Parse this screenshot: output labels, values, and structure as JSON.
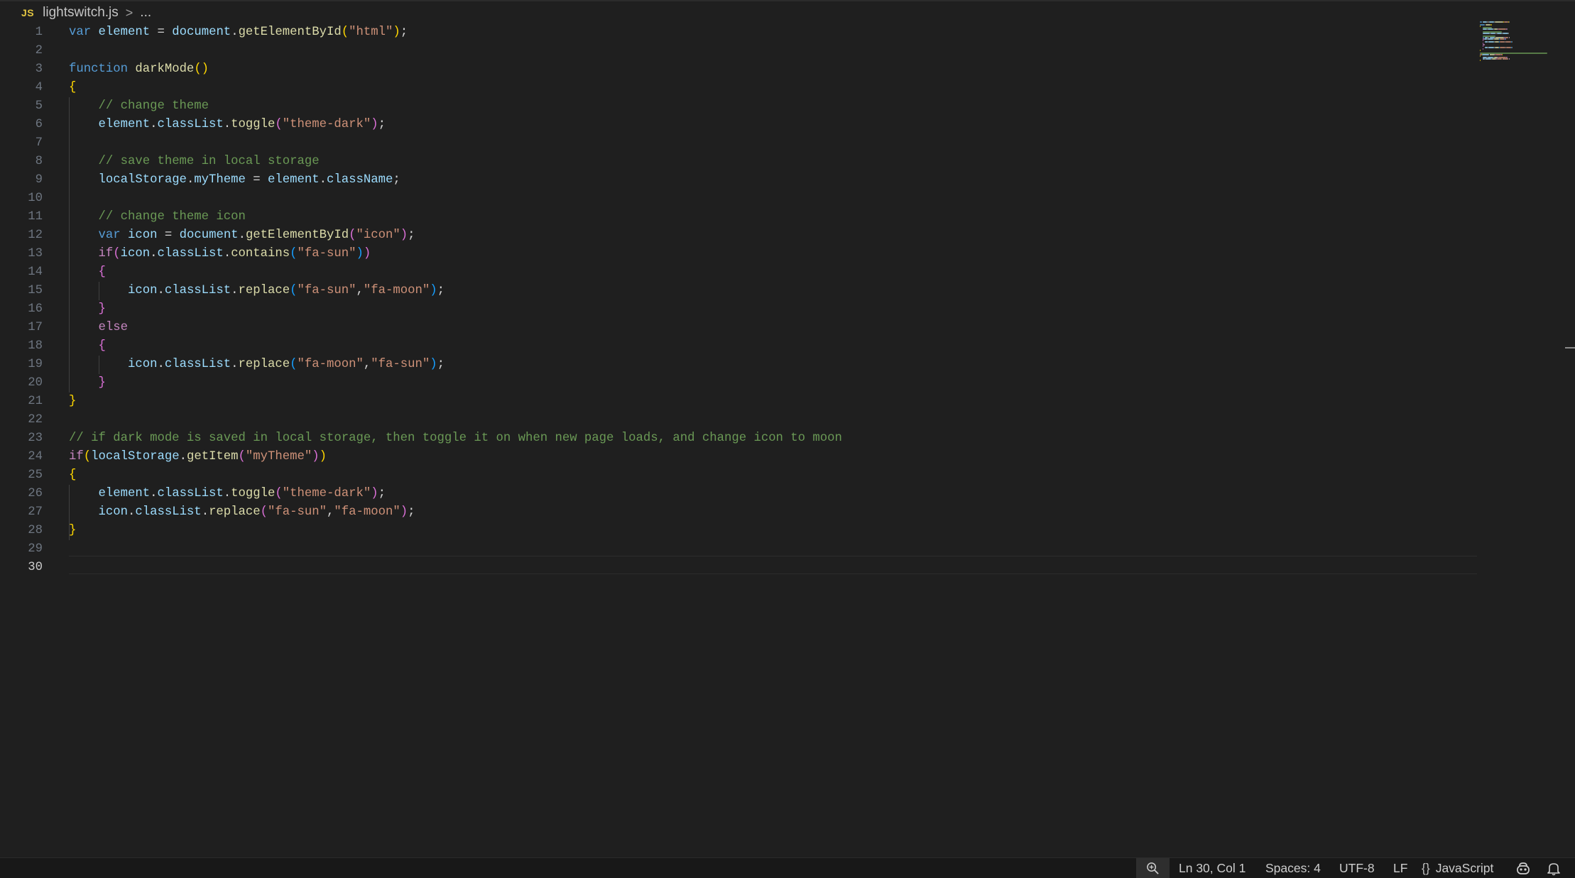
{
  "breadcrumb": {
    "badge": "JS",
    "file": "lightswitch.js",
    "separator": ">",
    "more": "..."
  },
  "editor": {
    "current_line": 30,
    "lines": [
      {
        "n": "1",
        "tokens": [
          [
            "kw",
            "var"
          ],
          [
            "pl",
            " "
          ],
          [
            "var",
            "element"
          ],
          [
            "pl",
            " = "
          ],
          [
            "var",
            "document"
          ],
          [
            "pl",
            "."
          ],
          [
            "fn",
            "getElementById"
          ],
          [
            "b1",
            "("
          ],
          [
            "str",
            "\"html\""
          ],
          [
            "b1",
            ")"
          ],
          [
            "pl",
            ";"
          ]
        ]
      },
      {
        "n": "2",
        "tokens": []
      },
      {
        "n": "3",
        "tokens": [
          [
            "kw",
            "function"
          ],
          [
            "pl",
            " "
          ],
          [
            "fn",
            "darkMode"
          ],
          [
            "b1",
            "()"
          ]
        ]
      },
      {
        "n": "4",
        "tokens": [
          [
            "b1",
            "{"
          ]
        ]
      },
      {
        "n": "5",
        "tokens": [
          [
            "pl",
            "    "
          ],
          [
            "com",
            "// change theme"
          ]
        ]
      },
      {
        "n": "6",
        "tokens": [
          [
            "pl",
            "    "
          ],
          [
            "var",
            "element"
          ],
          [
            "pl",
            "."
          ],
          [
            "var",
            "classList"
          ],
          [
            "pl",
            "."
          ],
          [
            "fn",
            "toggle"
          ],
          [
            "b2",
            "("
          ],
          [
            "str",
            "\"theme-dark\""
          ],
          [
            "b2",
            ")"
          ],
          [
            "pl",
            ";"
          ]
        ]
      },
      {
        "n": "7",
        "tokens": []
      },
      {
        "n": "8",
        "tokens": [
          [
            "pl",
            "    "
          ],
          [
            "com",
            "// save theme in local storage"
          ]
        ]
      },
      {
        "n": "9",
        "tokens": [
          [
            "pl",
            "    "
          ],
          [
            "var",
            "localStorage"
          ],
          [
            "pl",
            "."
          ],
          [
            "var",
            "myTheme"
          ],
          [
            "pl",
            " = "
          ],
          [
            "var",
            "element"
          ],
          [
            "pl",
            "."
          ],
          [
            "var",
            "className"
          ],
          [
            "pl",
            ";"
          ]
        ]
      },
      {
        "n": "10",
        "tokens": []
      },
      {
        "n": "11",
        "tokens": [
          [
            "pl",
            "    "
          ],
          [
            "com",
            "// change theme icon"
          ]
        ]
      },
      {
        "n": "12",
        "tokens": [
          [
            "pl",
            "    "
          ],
          [
            "kw",
            "var"
          ],
          [
            "pl",
            " "
          ],
          [
            "var",
            "icon"
          ],
          [
            "pl",
            " = "
          ],
          [
            "var",
            "document"
          ],
          [
            "pl",
            "."
          ],
          [
            "fn",
            "getElementById"
          ],
          [
            "b2",
            "("
          ],
          [
            "str",
            "\"icon\""
          ],
          [
            "b2",
            ")"
          ],
          [
            "pl",
            ";"
          ]
        ]
      },
      {
        "n": "13",
        "tokens": [
          [
            "pl",
            "    "
          ],
          [
            "ctl",
            "if"
          ],
          [
            "b2",
            "("
          ],
          [
            "var",
            "icon"
          ],
          [
            "pl",
            "."
          ],
          [
            "var",
            "classList"
          ],
          [
            "pl",
            "."
          ],
          [
            "fn",
            "contains"
          ],
          [
            "b3",
            "("
          ],
          [
            "str",
            "\"fa-sun\""
          ],
          [
            "b3",
            ")"
          ],
          [
            "b2",
            ")"
          ]
        ]
      },
      {
        "n": "14",
        "tokens": [
          [
            "pl",
            "    "
          ],
          [
            "b2",
            "{"
          ]
        ]
      },
      {
        "n": "15",
        "tokens": [
          [
            "pl",
            "        "
          ],
          [
            "var",
            "icon"
          ],
          [
            "pl",
            "."
          ],
          [
            "var",
            "classList"
          ],
          [
            "pl",
            "."
          ],
          [
            "fn",
            "replace"
          ],
          [
            "b3",
            "("
          ],
          [
            "str",
            "\"fa-sun\""
          ],
          [
            "pl",
            ","
          ],
          [
            "str",
            "\"fa-moon\""
          ],
          [
            "b3",
            ")"
          ],
          [
            "pl",
            ";"
          ]
        ]
      },
      {
        "n": "16",
        "tokens": [
          [
            "pl",
            "    "
          ],
          [
            "b2",
            "}"
          ]
        ]
      },
      {
        "n": "17",
        "tokens": [
          [
            "pl",
            "    "
          ],
          [
            "ctl",
            "else"
          ]
        ]
      },
      {
        "n": "18",
        "tokens": [
          [
            "pl",
            "    "
          ],
          [
            "b2",
            "{"
          ]
        ]
      },
      {
        "n": "19",
        "tokens": [
          [
            "pl",
            "        "
          ],
          [
            "var",
            "icon"
          ],
          [
            "pl",
            "."
          ],
          [
            "var",
            "classList"
          ],
          [
            "pl",
            "."
          ],
          [
            "fn",
            "replace"
          ],
          [
            "b3",
            "("
          ],
          [
            "str",
            "\"fa-moon\""
          ],
          [
            "pl",
            ","
          ],
          [
            "str",
            "\"fa-sun\""
          ],
          [
            "b3",
            ")"
          ],
          [
            "pl",
            ";"
          ]
        ]
      },
      {
        "n": "20",
        "tokens": [
          [
            "pl",
            "    "
          ],
          [
            "b2",
            "}"
          ]
        ]
      },
      {
        "n": "21",
        "tokens": [
          [
            "b1",
            "}"
          ]
        ]
      },
      {
        "n": "22",
        "tokens": []
      },
      {
        "n": "23",
        "tokens": [
          [
            "com",
            "// if dark mode is saved in local storage, then toggle it on when new page loads, and change icon to moon"
          ]
        ]
      },
      {
        "n": "24",
        "tokens": [
          [
            "ctl",
            "if"
          ],
          [
            "b1",
            "("
          ],
          [
            "var",
            "localStorage"
          ],
          [
            "pl",
            "."
          ],
          [
            "fn",
            "getItem"
          ],
          [
            "b2",
            "("
          ],
          [
            "str",
            "\"myTheme\""
          ],
          [
            "b2",
            ")"
          ],
          [
            "b1",
            ")"
          ]
        ]
      },
      {
        "n": "25",
        "tokens": [
          [
            "b1",
            "{"
          ]
        ]
      },
      {
        "n": "26",
        "tokens": [
          [
            "pl",
            "    "
          ],
          [
            "var",
            "element"
          ],
          [
            "pl",
            "."
          ],
          [
            "var",
            "classList"
          ],
          [
            "pl",
            "."
          ],
          [
            "fn",
            "toggle"
          ],
          [
            "b2",
            "("
          ],
          [
            "str",
            "\"theme-dark\""
          ],
          [
            "b2",
            ")"
          ],
          [
            "pl",
            ";"
          ]
        ]
      },
      {
        "n": "27",
        "tokens": [
          [
            "pl",
            "    "
          ],
          [
            "var",
            "icon"
          ],
          [
            "pl",
            "."
          ],
          [
            "var",
            "classList"
          ],
          [
            "pl",
            "."
          ],
          [
            "fn",
            "replace"
          ],
          [
            "b2",
            "("
          ],
          [
            "str",
            "\"fa-sun\""
          ],
          [
            "pl",
            ","
          ],
          [
            "str",
            "\"fa-moon\""
          ],
          [
            "b2",
            ")"
          ],
          [
            "pl",
            ";"
          ]
        ]
      },
      {
        "n": "28",
        "tokens": [
          [
            "b1",
            "}"
          ]
        ]
      },
      {
        "n": "29",
        "tokens": []
      },
      {
        "n": "30",
        "tokens": []
      }
    ]
  },
  "statusbar": {
    "zoom_icon": "zoom-icon",
    "position": "Ln 30, Col 1",
    "spaces": "Spaces: 4",
    "encoding": "UTF-8",
    "eol": "LF",
    "language_icon": "braces-icon",
    "language": "JavaScript",
    "copilot_icon": "copilot-icon",
    "bell_icon": "bell-icon"
  },
  "colors": {
    "background": "#1f1f1f",
    "keyword": "#569cd6",
    "control": "#c586c0",
    "function": "#dcdcaa",
    "variable": "#9cdcfe",
    "string": "#ce9178",
    "comment": "#6a9955",
    "bracket_1": "#ffd700",
    "bracket_2": "#da70d6",
    "bracket_3": "#179fff"
  }
}
